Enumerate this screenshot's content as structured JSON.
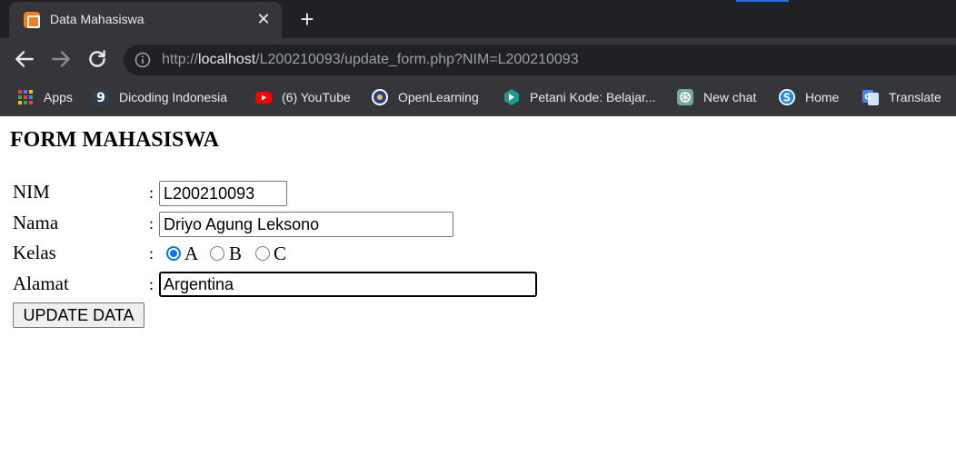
{
  "browser": {
    "tab": {
      "title": "Data Mahasiswa",
      "close_glyph": "✕",
      "favicon": "xampp-icon"
    },
    "new_tab_glyph": "+",
    "address": {
      "scheme": "http://",
      "host": "localhost",
      "path": "/L200210093/update_form.php?NIM=L200210093"
    },
    "bookmarks": [
      {
        "label": "Apps",
        "icon": "apps-grid-icon"
      },
      {
        "label": "Dicoding Indonesia",
        "icon": "dicoding-icon"
      },
      {
        "label": "(6) YouTube",
        "icon": "youtube-icon"
      },
      {
        "label": "OpenLearning",
        "icon": "openlearning-icon"
      },
      {
        "label": "Petani Kode: Belajar...",
        "icon": "petanikode-icon"
      },
      {
        "label": "New chat",
        "icon": "chatgpt-icon"
      },
      {
        "label": "Home",
        "icon": "skype-icon"
      },
      {
        "label": "Translate",
        "icon": "translate-icon"
      }
    ],
    "colors": {
      "tabstrip": "#202124",
      "toolbar": "#35363a",
      "text": "#e8eaed",
      "accent": "#1a73e8"
    }
  },
  "form": {
    "title": "FORM MAHASISWA",
    "separator": ":",
    "nim": {
      "label": "NIM",
      "value": "L200210093"
    },
    "nama": {
      "label": "Nama",
      "value": "Driyo Agung Leksono"
    },
    "kelas": {
      "label": "Kelas",
      "options": [
        "A",
        "B",
        "C"
      ],
      "selected": "A"
    },
    "alamat": {
      "label": "Alamat",
      "value": "Argentina"
    },
    "submit_label": "UPDATE DATA",
    "colors": {
      "radio_checked": "#0075ff"
    }
  }
}
